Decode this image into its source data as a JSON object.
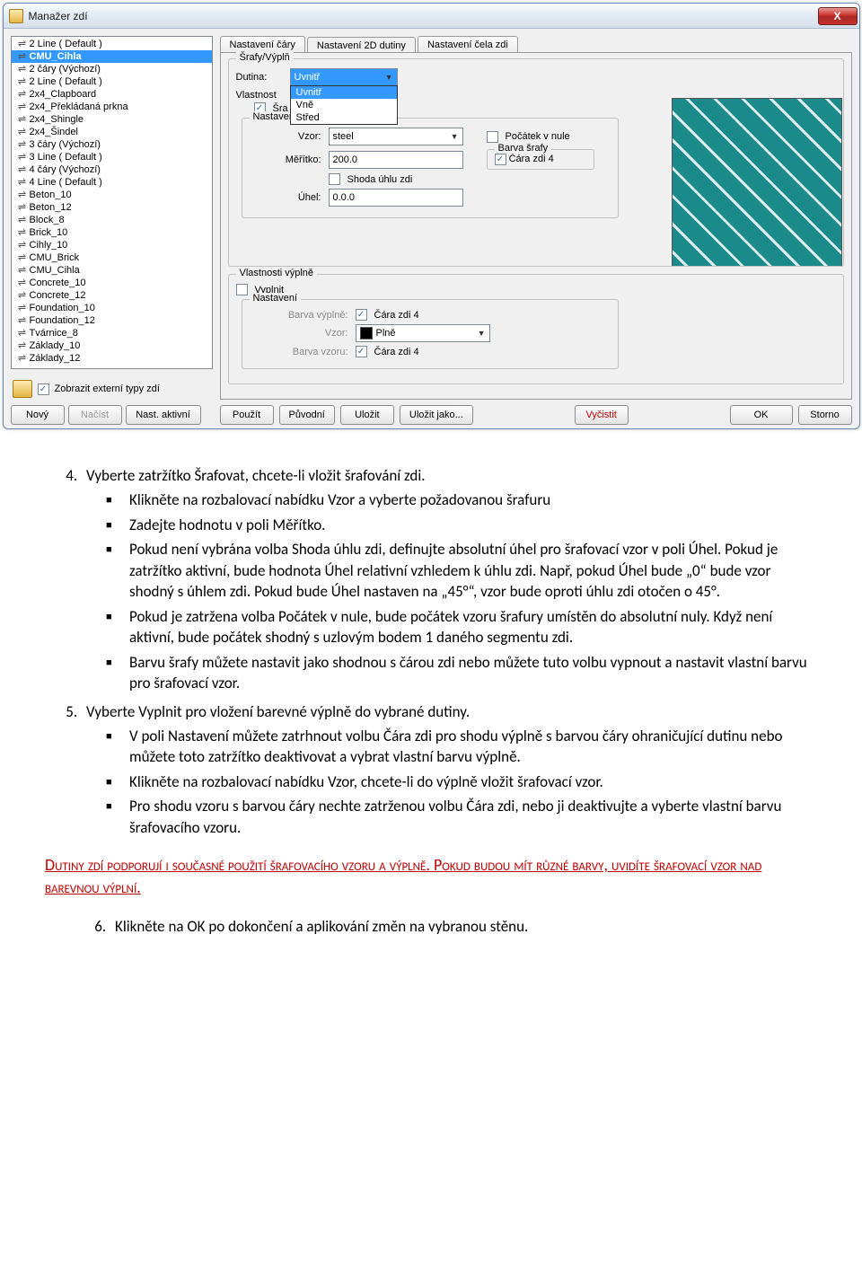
{
  "dialog": {
    "title": "Manažer zdí",
    "close_glyph": "X",
    "wall_types": [
      {
        "name": "2 Line ( Default )",
        "red": false,
        "sel": false
      },
      {
        "name": "CMU_Cihla",
        "red": true,
        "sel": true
      },
      {
        "name": "2 čáry (Výchozí)",
        "red": false,
        "sel": false
      },
      {
        "name": "2 Line ( Default )",
        "red": false,
        "sel": false
      },
      {
        "name": "2x4_Clapboard",
        "red": false,
        "sel": false
      },
      {
        "name": "2x4_Překládaná prkna",
        "red": false,
        "sel": false
      },
      {
        "name": "2x4_Shingle",
        "red": false,
        "sel": false
      },
      {
        "name": "2x4_Šindel",
        "red": false,
        "sel": false
      },
      {
        "name": "3 čáry (Výchozí)",
        "red": false,
        "sel": false
      },
      {
        "name": "3 Line ( Default )",
        "red": false,
        "sel": false
      },
      {
        "name": "4 čáry (Výchozí)",
        "red": false,
        "sel": false
      },
      {
        "name": "4 Line ( Default )",
        "red": false,
        "sel": false
      },
      {
        "name": "Beton_10",
        "red": false,
        "sel": false
      },
      {
        "name": "Beton_12",
        "red": false,
        "sel": false
      },
      {
        "name": "Block_8",
        "red": false,
        "sel": false
      },
      {
        "name": "Brick_10",
        "red": false,
        "sel": false
      },
      {
        "name": "Cihly_10",
        "red": false,
        "sel": false
      },
      {
        "name": "CMU_Brick",
        "red": false,
        "sel": false
      },
      {
        "name": "CMU_Cihla",
        "red": false,
        "sel": false
      },
      {
        "name": "Concrete_10",
        "red": false,
        "sel": false
      },
      {
        "name": "Concrete_12",
        "red": false,
        "sel": false
      },
      {
        "name": "Foundation_10",
        "red": false,
        "sel": false
      },
      {
        "name": "Foundation_12",
        "red": false,
        "sel": false
      },
      {
        "name": "Tvárnice_8",
        "red": false,
        "sel": false
      },
      {
        "name": "Základy_10",
        "red": false,
        "sel": false
      },
      {
        "name": "Základy_12",
        "red": false,
        "sel": false
      }
    ],
    "ext_types_label": "Zobrazit externí typy zdí",
    "btn_new": "Nový",
    "btn_load": "Načíst",
    "btn_set_active": "Nast. aktivní",
    "tabs": {
      "line": "Nastavení čáry",
      "cavity": "Nastavení 2D dutiny",
      "endcap": "Nastavení čela zdi"
    },
    "group_hatch": "Šrafy/Výplň",
    "dutina_label": "Dutina:",
    "dutina_value": "Uvnitř",
    "dutina_options": [
      "Uvnitř",
      "Vně",
      "Střed"
    ],
    "vlastnosti_label": "Vlastnost",
    "sra_label": "Šra",
    "group_settings": "Nastavení",
    "vzor_label": "Vzor:",
    "vzor_value": "steel",
    "origin_label": "Počátek v nule",
    "scale_label": "Měřítko:",
    "scale_value": "200.0",
    "hatch_color_group": "Barva šrafy",
    "wall_line4": "Čára zdi 4",
    "match_angle": "Shoda úhlu zdi",
    "angle_label": "Úhel:",
    "angle_value": "0.0.0",
    "fill_props_group": "Vlastnosti výplně",
    "fill_label": "Vyplnit",
    "fill_color_label": "Barva výplně:",
    "fill_pattern_label": "Vzor:",
    "fill_pattern_value": "Plně",
    "pattern_color_label": "Barva vzoru:",
    "btn_apply": "Použít",
    "btn_revert": "Původní",
    "btn_save": "Uložit",
    "btn_saveas": "Uložit jako...",
    "btn_purge": "Vyčistit",
    "btn_ok": "OK",
    "btn_cancel": "Storno"
  },
  "doc": {
    "li4": "Vyberte zatržítko Šrafovat, chcete-li vložit šrafování zdi.",
    "b4_1": "Klikněte na rozbalovací nabídku Vzor a vyberte požadovanou šrafuru",
    "b4_2": "Zadejte hodnotu v poli Měřítko.",
    "b4_3": "Pokud není vybrána volba Shoda úhlu zdi, definujte absolutní úhel pro šrafovací vzor v poli Úhel. Pokud je zatržítko aktivní, bude hodnota Úhel relativní vzhledem k úhlu zdi. Např, pokud Úhel bude „0“ bude vzor shodný s úhlem zdi. Pokud bude Úhel nastaven na „45°“, vzor bude oproti úhlu zdi otočen o 45°.",
    "b4_4": "Pokud je zatržena volba Počátek v nule, bude počátek vzoru šrafury umístěn do absolutní nuly. Když není aktivní, bude počátek shodný s uzlovým bodem 1 daného segmentu zdi.",
    "b4_5": "Barvu šrafy můžete nastavit jako shodnou s čárou zdi nebo můžete tuto volbu vypnout a nastavit vlastní barvu pro šrafovací vzor.",
    "li5": "Vyberte Vyplnit pro vložení barevné výplně do vybrané dutiny.",
    "b5_1": "V poli Nastavení můžete zatrhnout volbu Čára zdi pro shodu výplně s barvou čáry ohraničující dutinu nebo můžete toto zatržítko deaktivovat a vybrat vlastní barvu výplně.",
    "b5_2": "Klikněte na rozbalovací nabídku Vzor, chcete-li do výplně vložit šrafovací vzor.",
    "b5_3": "Pro shodu vzoru s barvou čáry nechte zatrženou volbu Čára zdi, nebo ji deaktivujte a vyberte vlastní barvu šrafovacího vzoru.",
    "note": "Dutiny zdí podporují i současné použití šrafovacího vzoru a výplně. Pokud budou mít různé barvy, uvidíte šrafovací vzor nad barevnou výplní.",
    "li6": "Klikněte na OK po dokončení a aplikování změn na vybranou stěnu."
  }
}
